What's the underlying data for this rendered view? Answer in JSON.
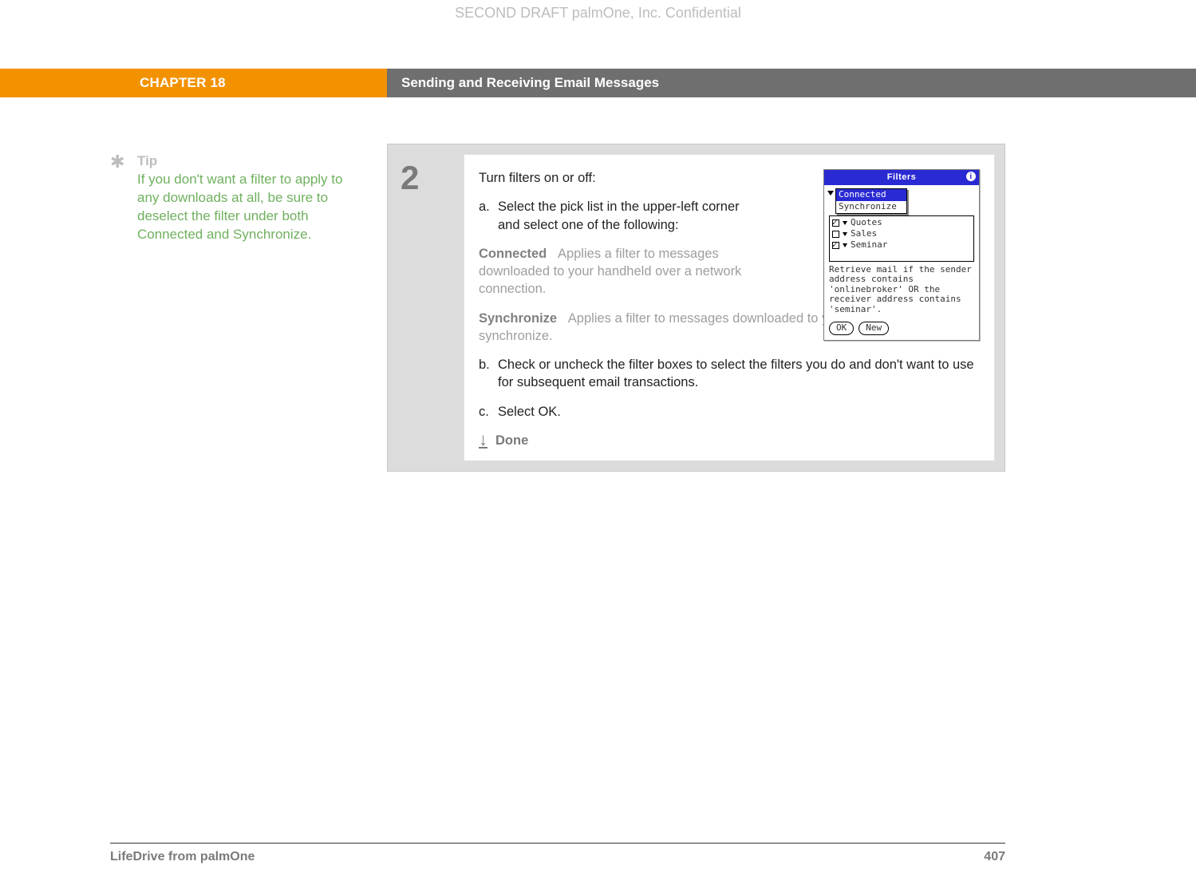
{
  "watermark": "SECOND DRAFT palmOne, Inc.  Confidential",
  "header": {
    "chapter": "CHAPTER 18",
    "section": "Sending and Receiving Email Messages"
  },
  "tip": {
    "label": "Tip",
    "body": "If you don't want a filter to apply to any downloads at all, be sure to deselect the filter under both Connected and Synchronize."
  },
  "step": {
    "number": "2",
    "intro": "Turn filters on or off:",
    "a_label": "a.",
    "a_text": "Select the pick list in the upper-left corner and select one of the following:",
    "defs": {
      "connected_term": "Connected",
      "connected_desc": "Applies a filter to messages downloaded to your handheld over a network connection.",
      "sync_term": "Synchronize",
      "sync_desc": "Applies a filter to messages downloaded to your handheld when you synchronize."
    },
    "b_label": "b.",
    "b_text": "Check or uncheck the filter boxes to select the filters you do and don't want to use for subsequent email transactions.",
    "c_label": "c.",
    "c_text": "Select OK.",
    "done": "Done"
  },
  "device": {
    "title": "Filters",
    "dropdown": {
      "selected": "Connected",
      "other": "Synchronize"
    },
    "filters": {
      "quotes": "Quotes",
      "sales": "Sales",
      "seminar": "Seminar"
    },
    "desc": "Retrieve mail if the sender address contains 'onlinebroker' OR the receiver address contains 'seminar'.",
    "ok": "OK",
    "new": "New"
  },
  "footer": {
    "product": "LifeDrive from palmOne",
    "page": "407"
  }
}
